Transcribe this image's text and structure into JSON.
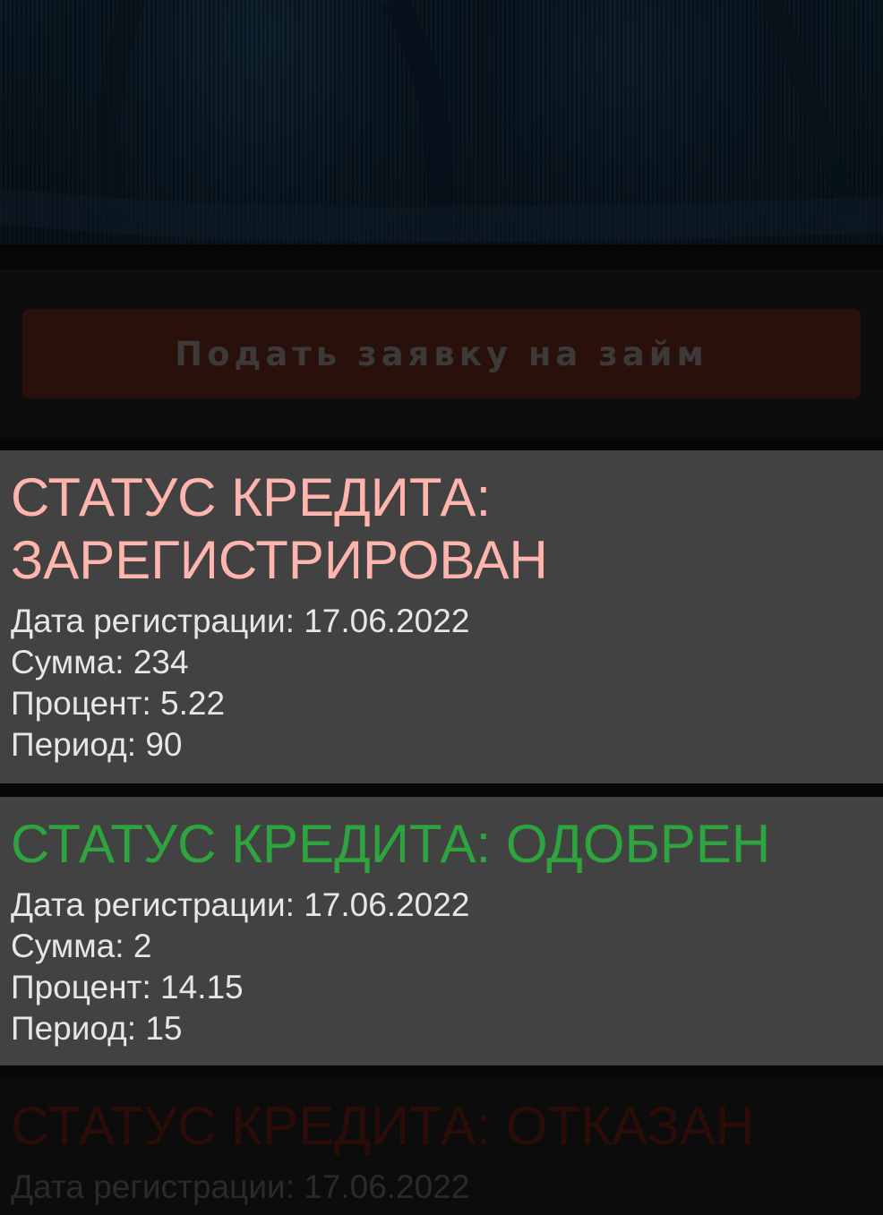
{
  "header": {
    "background": "dark blue abstract texture"
  },
  "apply_button": {
    "label": "Подать заявку на займ"
  },
  "colors": {
    "registered": "#ffb5ad",
    "approved": "#2ea43f",
    "rejected": "#2b0c07",
    "card_bg": "#424242",
    "detail_text": "#e6e6e6"
  },
  "loans": [
    {
      "status_title": "СТАТУС КРЕДИТА: ЗАРЕГИСТРИРОВАН",
      "date_line": "Дата регистрации: 17.06.2022",
      "amount_line": "Сумма: 234",
      "percent_line": "Процент: 5.22",
      "period_line": "Период: 90"
    },
    {
      "status_title": "СТАТУС КРЕДИТА: ОДОБРЕН",
      "date_line": "Дата регистрации: 17.06.2022",
      "amount_line": "Сумма: 2",
      "percent_line": "Процент: 14.15",
      "period_line": "Период: 15"
    },
    {
      "status_title": "СТАТУС КРЕДИТА: ОТКАЗАН",
      "date_line": "Дата регистрации: 17.06.2022"
    }
  ]
}
